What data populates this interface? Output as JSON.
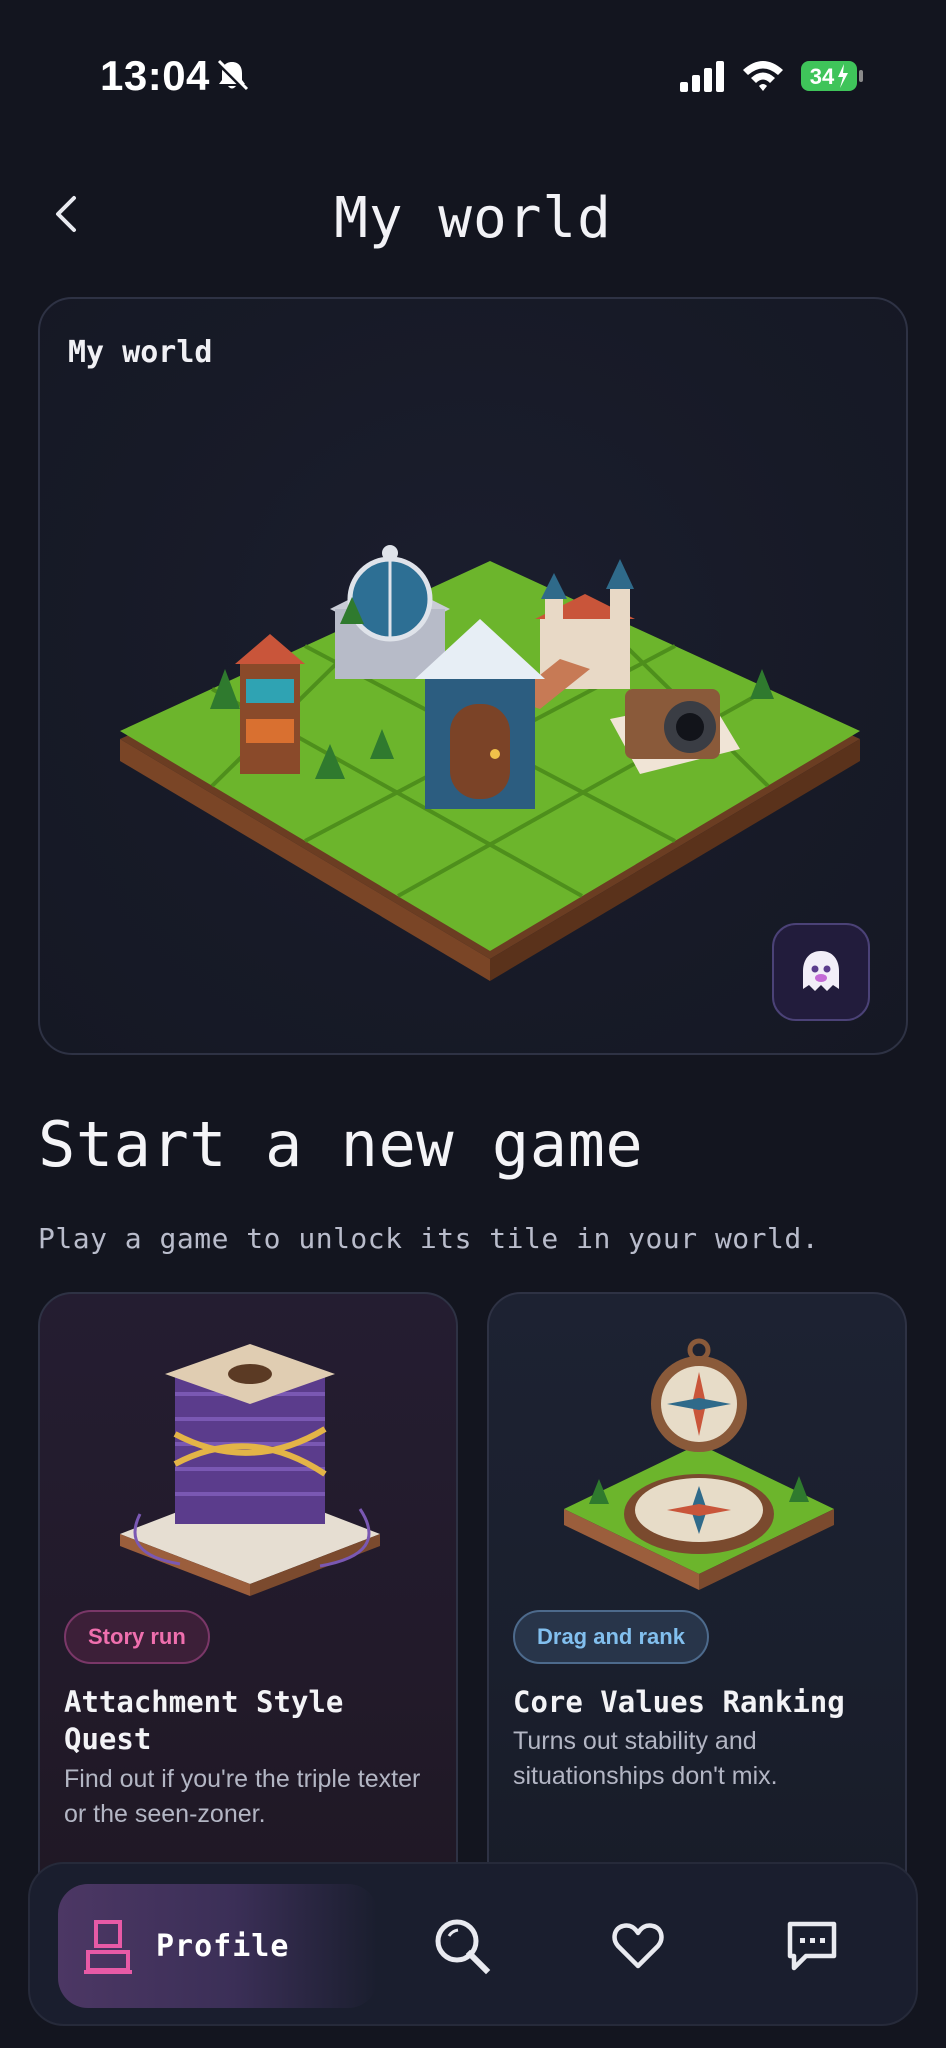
{
  "status_bar": {
    "time": "13:04",
    "battery": "34",
    "icons": [
      "bell-slash-icon",
      "cellular-signal-icon",
      "wifi-icon",
      "battery-charging-icon"
    ]
  },
  "header": {
    "back_icon": "chevron-left-icon",
    "title": "My world"
  },
  "world_card": {
    "label": "My world",
    "image": "isometric-world-tiles",
    "ghost_icon": "ghost-icon"
  },
  "section": {
    "title": "Start a new game",
    "subtitle": "Play a game to unlock its tile in your world."
  },
  "games": [
    {
      "tag": "Story run",
      "title": "Attachment Style Quest",
      "description": "Find out if you're the triple texter or the seen-zoner.",
      "image": "yarn-spool-tile",
      "tag_color": "#ef6fae"
    },
    {
      "tag": "Drag and rank",
      "title": "Core Values Ranking",
      "description": "Turns out stability and situationships don't mix.",
      "image": "compass-tile",
      "tag_color": "#82bfee"
    }
  ],
  "bottom_nav": {
    "active": "Profile",
    "profile_label": "Profile",
    "items": [
      "user-icon",
      "search-icon",
      "heart-icon",
      "chat-icon"
    ],
    "accent": "#e75aa6"
  }
}
